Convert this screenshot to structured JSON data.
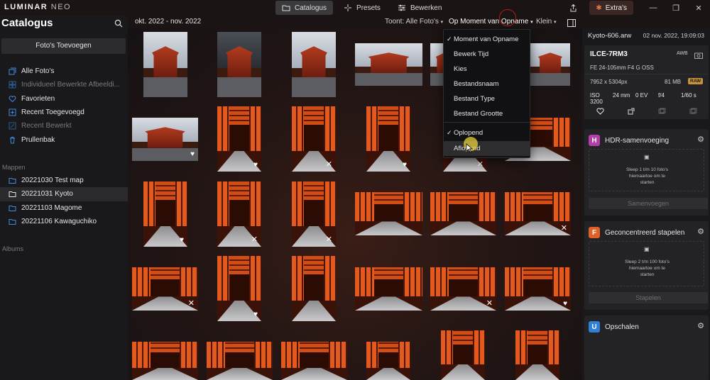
{
  "app": {
    "logo_main": "LUMINAR",
    "logo_sub": "NEO"
  },
  "top_tabs": [
    {
      "label": "Catalogus",
      "active": true
    },
    {
      "label": "Presets",
      "active": false
    },
    {
      "label": "Bewerken",
      "active": false
    }
  ],
  "top_right": {
    "extras_label": "Extra's"
  },
  "left_panel": {
    "title": "Catalogus",
    "add_button": "Foto's Toevoegen",
    "library_items": [
      {
        "label": "Alle Foto's",
        "dim": false
      },
      {
        "label": "Individueel Bewerkte Afbeeldi...",
        "dim": true
      },
      {
        "label": "Favorieten",
        "dim": false
      },
      {
        "label": "Recent Toegevoegd",
        "dim": false
      },
      {
        "label": "Recent Bewerkt",
        "dim": true
      },
      {
        "label": "Prullenbak",
        "dim": false
      }
    ],
    "folders_label": "Mappen",
    "folders": [
      {
        "label": "20221030 Test map",
        "selected": false
      },
      {
        "label": "20221031 Kyoto",
        "selected": true
      },
      {
        "label": "20221103 Magome",
        "selected": false
      },
      {
        "label": "20221106 Kawaguchiko",
        "selected": false
      }
    ],
    "albums_label": "Albums"
  },
  "header": {
    "date_range": "okt. 2022 - nov. 2022",
    "show_filter": "Toont: Alle Foto's",
    "sort_filter": "Op Moment van Opname",
    "size_filter": "Klein"
  },
  "sort_menu": {
    "items": [
      {
        "label": "Moment van Opname",
        "checked": true
      },
      {
        "label": "Bewerk Tijd",
        "checked": false
      },
      {
        "label": "Kies",
        "checked": false
      },
      {
        "label": "Bestandsnaam",
        "checked": false
      },
      {
        "label": "Bestand Type",
        "checked": false
      },
      {
        "label": "Bestand Grootte",
        "checked": false
      }
    ],
    "order_items": [
      {
        "label": "Oplopend",
        "checked": true
      },
      {
        "label": "Aflopend",
        "checked": false,
        "hover": true
      }
    ]
  },
  "photo_grid": [
    {
      "type": "temple",
      "badge": ""
    },
    {
      "type": "temple-dark",
      "badge": ""
    },
    {
      "type": "temple",
      "badge": ""
    },
    {
      "type": "temple",
      "badge": ""
    },
    {
      "type": "temple",
      "badge": ""
    },
    {
      "type": "temple",
      "badge": ""
    },
    {
      "type": "temple",
      "badge": "heart"
    },
    {
      "type": "torii",
      "badge": "heart"
    },
    {
      "type": "torii",
      "badge": "reject"
    },
    {
      "type": "torii",
      "badge": "heart"
    },
    {
      "type": "torii",
      "badge": "reject"
    },
    {
      "type": "torii",
      "badge": ""
    },
    {
      "type": "torii",
      "badge": "heart"
    },
    {
      "type": "torii",
      "badge": "reject"
    },
    {
      "type": "torii",
      "badge": "reject"
    },
    {
      "type": "torii",
      "badge": ""
    },
    {
      "type": "torii",
      "badge": ""
    },
    {
      "type": "torii",
      "badge": "reject"
    },
    {
      "type": "torii",
      "badge": "reject"
    },
    {
      "type": "torii",
      "badge": "heart"
    },
    {
      "type": "torii",
      "badge": ""
    },
    {
      "type": "torii",
      "badge": ""
    },
    {
      "type": "torii",
      "badge": "reject"
    },
    {
      "type": "torii",
      "badge": "heart"
    },
    {
      "type": "torii",
      "badge": ""
    },
    {
      "type": "torii",
      "badge": ""
    },
    {
      "type": "torii",
      "badge": ""
    },
    {
      "type": "torii",
      "badge": ""
    },
    {
      "type": "torii",
      "badge": ""
    },
    {
      "type": "torii",
      "badge": ""
    },
    {
      "type": "torii",
      "badge": ""
    },
    {
      "type": "torii",
      "badge": ""
    }
  ],
  "info_panel": {
    "filename": "Kyoto-606.arw",
    "datetime": "02 nov. 2022, 19:09:03",
    "camera": "ILCE-7RM3",
    "wb": "AWB",
    "lens": "FE 24-105mm F4 G OSS",
    "dimensions": "7952 x 5304px",
    "filesize": "81 MB",
    "format": "RAW",
    "exif": [
      "ISO 3200",
      "24 mm",
      "0 EV",
      "f/4",
      "1/60 s"
    ]
  },
  "tools": [
    {
      "title": "HDR-samenvoeging",
      "icon_letter": "H",
      "icon_color": "#b23fa8",
      "drop_text": [
        "Sleep 1 t/m 10 foto's",
        "hiernaartoe om te",
        "starten"
      ],
      "button": "Samenvoegen"
    },
    {
      "title": "Geconcentreerd stapelen",
      "icon_letter": "F",
      "icon_color": "#e0602a",
      "drop_text": [
        "Sleep 2 t/m 100 foto's",
        "hiernaartoe om te",
        "starten"
      ],
      "button": "Stapelen"
    },
    {
      "title": "Opschalen",
      "icon_letter": "U",
      "icon_color": "#2f7fd8",
      "drop_text": [],
      "button": ""
    }
  ]
}
